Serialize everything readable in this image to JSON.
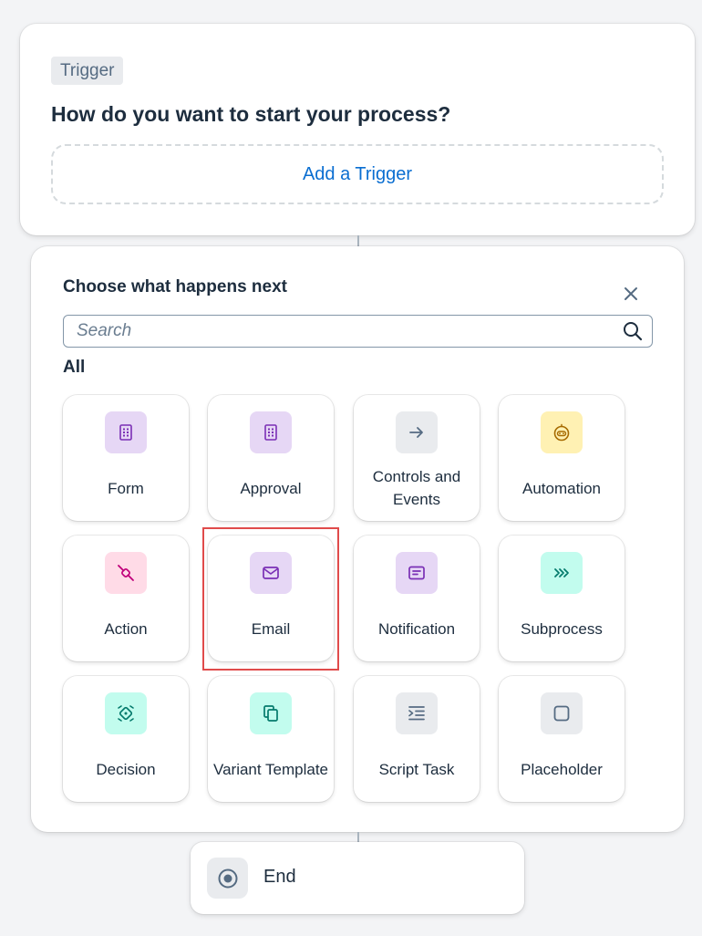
{
  "trigger": {
    "badge": "Trigger",
    "title": "How do you want to start your process?",
    "add_label": "Add a Trigger"
  },
  "panel": {
    "title": "Choose what happens next",
    "close_icon": "close-icon",
    "search": {
      "placeholder": "Search",
      "value": "",
      "icon": "search-icon"
    },
    "section_label": "All",
    "tiles": [
      {
        "label": "Form",
        "icon": "form-icon",
        "icon_bg": "#e6d7f5"
      },
      {
        "label": "Approval",
        "icon": "approval-icon",
        "icon_bg": "#e6d7f5"
      },
      {
        "label": "Controls and Events",
        "icon": "arrow-right-icon",
        "icon_bg": "#e9ebee"
      },
      {
        "label": "Automation",
        "icon": "robot-icon",
        "icon_bg": "#fff1b3"
      },
      {
        "label": "Action",
        "icon": "connector-icon",
        "icon_bg": "#ffdbe7"
      },
      {
        "label": "Email",
        "icon": "envelope-icon",
        "icon_bg": "#e6d7f5",
        "highlighted": true
      },
      {
        "label": "Notification",
        "icon": "message-icon",
        "icon_bg": "#e6d7f5"
      },
      {
        "label": "Subprocess",
        "icon": "chevrons-right-icon",
        "icon_bg": "#c2fcee"
      },
      {
        "label": "Decision",
        "icon": "decision-icon",
        "icon_bg": "#c2fcee"
      },
      {
        "label": "Variant Template",
        "icon": "copy-icon",
        "icon_bg": "#c2fcee"
      },
      {
        "label": "Script Task",
        "icon": "script-icon",
        "icon_bg": "#e9ebee"
      },
      {
        "label": "Placeholder",
        "icon": "square-icon",
        "icon_bg": "#e9ebee"
      }
    ]
  },
  "end": {
    "label": "End",
    "icon": "stop-icon"
  },
  "colors": {
    "link": "#0a6ed1",
    "text": "#1d2d3e",
    "highlight_border": "#e04b4b",
    "background": "#f3f4f6"
  }
}
